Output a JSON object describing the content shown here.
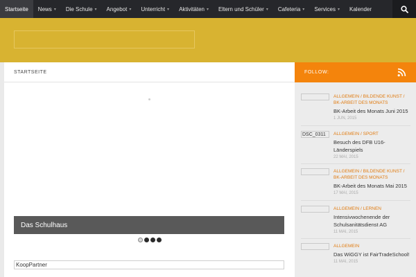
{
  "nav": {
    "items": [
      {
        "label": "Startseite",
        "dropdown": false,
        "active": true
      },
      {
        "label": "News",
        "dropdown": true
      },
      {
        "label": "Die Schule",
        "dropdown": true
      },
      {
        "label": "Angebot",
        "dropdown": true
      },
      {
        "label": "Unterricht",
        "dropdown": true
      },
      {
        "label": "Aktivitäten",
        "dropdown": true
      },
      {
        "label": "Eltern und Schüler",
        "dropdown": true
      },
      {
        "label": "Cafeteria",
        "dropdown": true
      },
      {
        "label": "Services",
        "dropdown": true
      },
      {
        "label": "Kalender",
        "dropdown": false
      }
    ],
    "search_icon": "search-icon",
    "colors": {
      "bar": "#26272b",
      "active": "#3b3c40"
    }
  },
  "header": {
    "color": "#d8b331"
  },
  "main": {
    "page_title": "STARTSEITE",
    "slider": {
      "caption": "Das Schulhaus",
      "dots": 4,
      "current": 0
    },
    "koop_partner": "KoopPartner"
  },
  "sidebar": {
    "follow_label": "FOLLOW:",
    "follow_icon": "rss-icon",
    "accent": "#f4840c",
    "posts": [
      {
        "thumb": "",
        "categories": [
          "ALLGEMEIN",
          "BILDENDE KUNST",
          "BK-ARBEIT DES MONATS"
        ],
        "cat_text": "ALLGEMEIN / BILDENDE KUNST / BK-ARBEIT DES MONATS",
        "title": "BK-Arbeit des Monats Juni 2015",
        "date": "1 JUN, 2015"
      },
      {
        "thumb": "DSC_0311",
        "categories": [
          "ALLGEMEIN",
          "SPORT"
        ],
        "cat_text": "ALLGEMEIN / SPORT",
        "title": "Besuch des DFB U16-Länderspiels",
        "date": "22 MAI, 2015"
      },
      {
        "thumb": "",
        "categories": [
          "ALLGEMEIN",
          "BILDENDE KUNST",
          "BK-ARBEIT DES MONATS"
        ],
        "cat_text": "ALLGEMEIN / BILDENDE KUNST / BK-ARBEIT DES MONATS",
        "title": "BK-Arbeit des Monats Mai 2015",
        "date": "17 MAI, 2015"
      },
      {
        "thumb": "",
        "categories": [
          "ALLGEMEIN",
          "LERNEN"
        ],
        "cat_text": "ALLGEMEIN / LERNEN",
        "title": "Intensivwochenende der Schulsanitätsdienst AG",
        "date": "11 MAI, 2015"
      },
      {
        "thumb": "",
        "categories": [
          "ALLGEMEIN"
        ],
        "cat_text": "ALLGEMEIN",
        "title": "Das WiGGY ist FairTradeSchool!",
        "date": "11 MAI, 2015"
      }
    ]
  }
}
